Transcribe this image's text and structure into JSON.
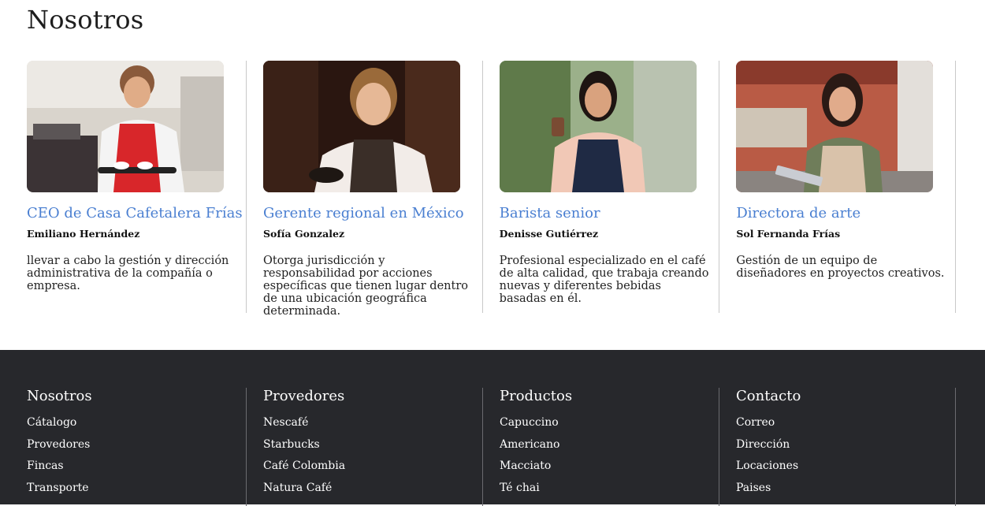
{
  "page": {
    "title": "Nosotros"
  },
  "team": [
    {
      "role": "CEO de Casa Cafetalera Frías",
      "name": "Emiliano Hernández",
      "description": "llevar a cabo la gestión y dirección administrativa de la compañía o empresa."
    },
    {
      "role": "Gerente regional en México",
      "name": "Sofía Gonzalez",
      "description": "Otorga jurisdicción y responsabilidad por acciones específicas que tienen lugar dentro de una ubicación geográfica determinada."
    },
    {
      "role": "Barista senior",
      "name": "Denisse Gutiérrez",
      "description": "Profesional especializado en el café de alta calidad, que trabaja creando nuevas y diferentes bebidas basadas en él."
    },
    {
      "role": "Directora de arte",
      "name": "Sol Fernanda Frías",
      "description": "Gestión de un equipo de diseñadores en proyectos creativos."
    }
  ],
  "footer": {
    "columns": [
      {
        "title": "Nosotros",
        "links": [
          "Cátalogo",
          "Provedores",
          "Fincas",
          "Transporte"
        ]
      },
      {
        "title": "Provedores",
        "links": [
          "Nescafé",
          "Starbucks",
          "Café Colombia",
          "Natura Café"
        ]
      },
      {
        "title": "Productos",
        "links": [
          "Capuccino",
          "Americano",
          "Macciato",
          "Té chai"
        ]
      },
      {
        "title": "Contacto",
        "links": [
          "Correo",
          "Dirección",
          "Locaciones",
          "Paises"
        ]
      }
    ]
  },
  "colors": {
    "accent": "#4a7fd1",
    "footer_bg": "#27282c"
  }
}
